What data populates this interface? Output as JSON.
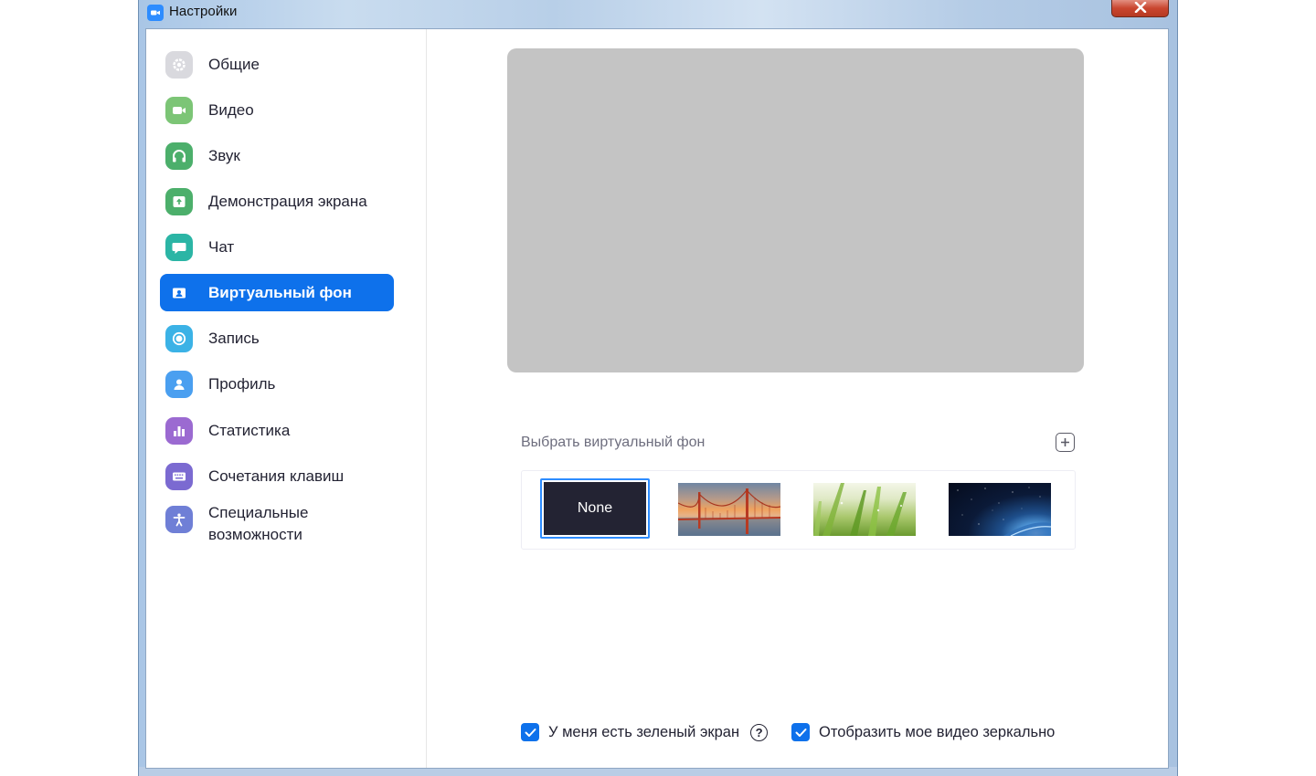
{
  "window": {
    "title": "Настройки",
    "close_icon": "close-icon"
  },
  "sidebar": {
    "items": [
      {
        "id": "general",
        "label": "Общие",
        "icon": "gear-icon",
        "color": "#d9d9de",
        "active": false
      },
      {
        "id": "video",
        "label": "Видео",
        "icon": "video-camera-icon",
        "color": "#7cc576",
        "active": false
      },
      {
        "id": "audio",
        "label": "Звук",
        "icon": "headphones-icon",
        "color": "#4caf6b",
        "active": false
      },
      {
        "id": "share-screen",
        "label": "Демонстрация экрана",
        "icon": "share-screen-icon",
        "color": "#4caf6b",
        "active": false
      },
      {
        "id": "chat",
        "label": "Чат",
        "icon": "chat-bubble-icon",
        "color": "#2bb5a5",
        "active": false
      },
      {
        "id": "virtual-background",
        "label": "Виртуальный фон",
        "icon": "person-card-icon",
        "color": "#0e71eb",
        "active": true
      },
      {
        "id": "recording",
        "label": "Запись",
        "icon": "record-icon",
        "color": "#3bb2e6",
        "active": false
      },
      {
        "id": "profile",
        "label": "Профиль",
        "icon": "profile-icon",
        "color": "#4a9ff0",
        "active": false
      },
      {
        "id": "statistics",
        "label": "Статистика",
        "icon": "bar-chart-icon",
        "color": "#9b6ad1",
        "active": false
      },
      {
        "id": "keyboard-shortcuts",
        "label": "Сочетания клавиш",
        "icon": "keyboard-icon",
        "color": "#7b6ad1",
        "active": false
      },
      {
        "id": "accessibility",
        "label": "Специальные\nвозможности",
        "icon": "accessibility-icon",
        "color": "#6f7fd6",
        "active": false
      }
    ]
  },
  "main": {
    "choose_label": "Выбрать виртуальный фон",
    "add_icon": "plus-square-icon",
    "backgrounds": [
      {
        "id": "none",
        "label": "None",
        "selected": true
      },
      {
        "id": "golden-gate",
        "label": "",
        "selected": false
      },
      {
        "id": "grass",
        "label": "",
        "selected": false
      },
      {
        "id": "earth-space",
        "label": "",
        "selected": false
      }
    ],
    "options": {
      "green_screen": {
        "label": "У меня есть зеленый экран",
        "checked": true
      },
      "mirror_video": {
        "label": "Отобразить мое видео зеркально",
        "checked": true
      },
      "help_glyph": "?"
    }
  },
  "colors": {
    "accent": "#0e71eb",
    "selection_border": "#2d8cff",
    "preview_gray": "#c4c4c4"
  }
}
